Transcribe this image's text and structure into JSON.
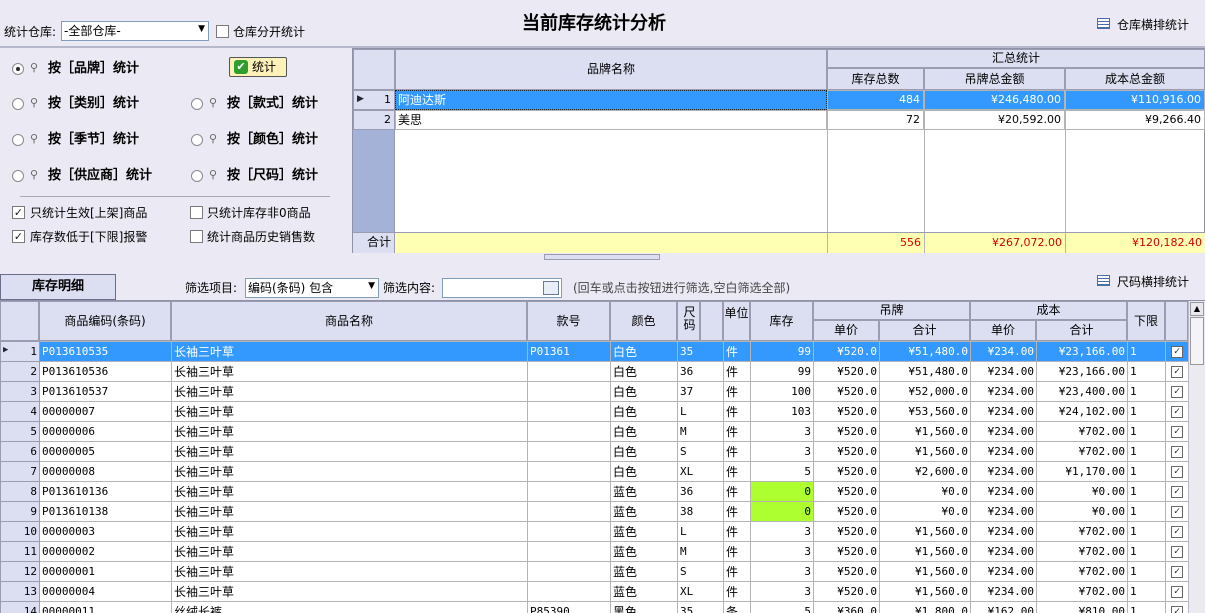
{
  "header": {
    "warehouse_label": "统计仓库:",
    "warehouse_value": "-全部仓库-",
    "warehouse_split_label": "仓库分开统计",
    "title": "当前库存统计分析",
    "warehouse_pivot_label": "仓库横排统计"
  },
  "options": {
    "stat_button": "统计",
    "by_brand": "按［品牌］统计",
    "by_category": "按［类别］统计",
    "by_style": "按［款式］统计",
    "by_season": "按［季节］统计",
    "by_color": "按［颜色］统计",
    "by_supplier": "按［供应商］统计",
    "by_size": "按［尺码］统计",
    "only_active": "只统计生效[上架]商品",
    "only_nonzero": "只统计库存非0商品",
    "low_stock_alert": "库存数低于[下限]报警",
    "history_sales": "统计商品历史销售数"
  },
  "summary": {
    "col_brand": "品牌名称",
    "group_total": "汇总统计",
    "col_stock": "库存总数",
    "col_tag": "吊牌总金额",
    "col_cost": "成本总金额",
    "rows": [
      {
        "no": "1",
        "brand": "阿迪达斯",
        "stock": "484",
        "tag": "¥246,480.00",
        "cost": "¥110,916.00"
      },
      {
        "no": "2",
        "brand": "美思",
        "stock": "72",
        "tag": "¥20,592.00",
        "cost": "¥9,266.40"
      }
    ],
    "total_label": "合计",
    "total_stock": "556",
    "total_tag": "¥267,072.00",
    "total_cost": "¥120,182.40"
  },
  "detail": {
    "tab_label": "库存明细",
    "filter_item_label": "筛选项目:",
    "filter_item_value": "编码(条码) 包含",
    "filter_content_label": "筛选内容:",
    "filter_hint": "(回车或点击按钮进行筛选,空白筛选全部)",
    "size_pivot_label": "尺码横排统计",
    "headers": {
      "code": "商品编码(条码)",
      "name": "商品名称",
      "style": "款号",
      "color": "颜色",
      "size": "尺码",
      "unit": "单位",
      "stock": "库存",
      "tag": "吊牌",
      "tag_price": "单价",
      "tag_sum": "合计",
      "cost": "成本",
      "cost_price": "单价",
      "cost_sum": "合计",
      "min": "下限"
    },
    "rows": [
      {
        "no": "1",
        "code": "P013610535",
        "name": "长袖三叶草",
        "style": "P01361",
        "color": "白色",
        "size": "35",
        "unit": "件",
        "stock": "99",
        "tp": "¥520.0",
        "ts": "¥51,480.0",
        "cp": "¥234.00",
        "cs": "¥23,166.00",
        "min": "1"
      },
      {
        "no": "2",
        "code": "P013610536",
        "name": "长袖三叶草",
        "style": "",
        "color": "白色",
        "size": "36",
        "unit": "件",
        "stock": "99",
        "tp": "¥520.0",
        "ts": "¥51,480.0",
        "cp": "¥234.00",
        "cs": "¥23,166.00",
        "min": "1"
      },
      {
        "no": "3",
        "code": "P013610537",
        "name": "长袖三叶草",
        "style": "",
        "color": "白色",
        "size": "37",
        "unit": "件",
        "stock": "100",
        "tp": "¥520.0",
        "ts": "¥52,000.0",
        "cp": "¥234.00",
        "cs": "¥23,400.00",
        "min": "1"
      },
      {
        "no": "4",
        "code": "00000007",
        "name": "长袖三叶草",
        "style": "",
        "color": "白色",
        "size": "L",
        "unit": "件",
        "stock": "103",
        "tp": "¥520.0",
        "ts": "¥53,560.0",
        "cp": "¥234.00",
        "cs": "¥24,102.00",
        "min": "1"
      },
      {
        "no": "5",
        "code": "00000006",
        "name": "长袖三叶草",
        "style": "",
        "color": "白色",
        "size": "M",
        "unit": "件",
        "stock": "3",
        "tp": "¥520.0",
        "ts": "¥1,560.0",
        "cp": "¥234.00",
        "cs": "¥702.00",
        "min": "1"
      },
      {
        "no": "6",
        "code": "00000005",
        "name": "长袖三叶草",
        "style": "",
        "color": "白色",
        "size": "S",
        "unit": "件",
        "stock": "3",
        "tp": "¥520.0",
        "ts": "¥1,560.0",
        "cp": "¥234.00",
        "cs": "¥702.00",
        "min": "1"
      },
      {
        "no": "7",
        "code": "00000008",
        "name": "长袖三叶草",
        "style": "",
        "color": "白色",
        "size": "XL",
        "unit": "件",
        "stock": "5",
        "tp": "¥520.0",
        "ts": "¥2,600.0",
        "cp": "¥234.00",
        "cs": "¥1,170.00",
        "min": "1"
      },
      {
        "no": "8",
        "code": "P013610136",
        "name": "长袖三叶草",
        "style": "",
        "color": "蓝色",
        "size": "36",
        "unit": "件",
        "stock": "0",
        "tp": "¥520.0",
        "ts": "¥0.0",
        "cp": "¥234.00",
        "cs": "¥0.00",
        "min": "1"
      },
      {
        "no": "9",
        "code": "P013610138",
        "name": "长袖三叶草",
        "style": "",
        "color": "蓝色",
        "size": "38",
        "unit": "件",
        "stock": "0",
        "tp": "¥520.0",
        "ts": "¥0.0",
        "cp": "¥234.00",
        "cs": "¥0.00",
        "min": "1"
      },
      {
        "no": "10",
        "code": "00000003",
        "name": "长袖三叶草",
        "style": "",
        "color": "蓝色",
        "size": "L",
        "unit": "件",
        "stock": "3",
        "tp": "¥520.0",
        "ts": "¥1,560.0",
        "cp": "¥234.00",
        "cs": "¥702.00",
        "min": "1"
      },
      {
        "no": "11",
        "code": "00000002",
        "name": "长袖三叶草",
        "style": "",
        "color": "蓝色",
        "size": "M",
        "unit": "件",
        "stock": "3",
        "tp": "¥520.0",
        "ts": "¥1,560.0",
        "cp": "¥234.00",
        "cs": "¥702.00",
        "min": "1"
      },
      {
        "no": "12",
        "code": "00000001",
        "name": "长袖三叶草",
        "style": "",
        "color": "蓝色",
        "size": "S",
        "unit": "件",
        "stock": "3",
        "tp": "¥520.0",
        "ts": "¥1,560.0",
        "cp": "¥234.00",
        "cs": "¥702.00",
        "min": "1"
      },
      {
        "no": "13",
        "code": "00000004",
        "name": "长袖三叶草",
        "style": "",
        "color": "蓝色",
        "size": "XL",
        "unit": "件",
        "stock": "3",
        "tp": "¥520.0",
        "ts": "¥1,560.0",
        "cp": "¥234.00",
        "cs": "¥702.00",
        "min": "1"
      },
      {
        "no": "14",
        "code": "00000011",
        "name": "丝绒长裤",
        "style": "P85390",
        "color": "黑色",
        "size": "35",
        "unit": "条",
        "stock": "5",
        "tp": "¥360.0",
        "ts": "¥1,800.0",
        "cp": "¥162.00",
        "cs": "¥810.00",
        "min": "1"
      }
    ]
  },
  "colors": {
    "selected": "#3399ff",
    "zero_stock": "#adff2f",
    "total_row": "#ffffb4",
    "total_text": "#d40000"
  }
}
